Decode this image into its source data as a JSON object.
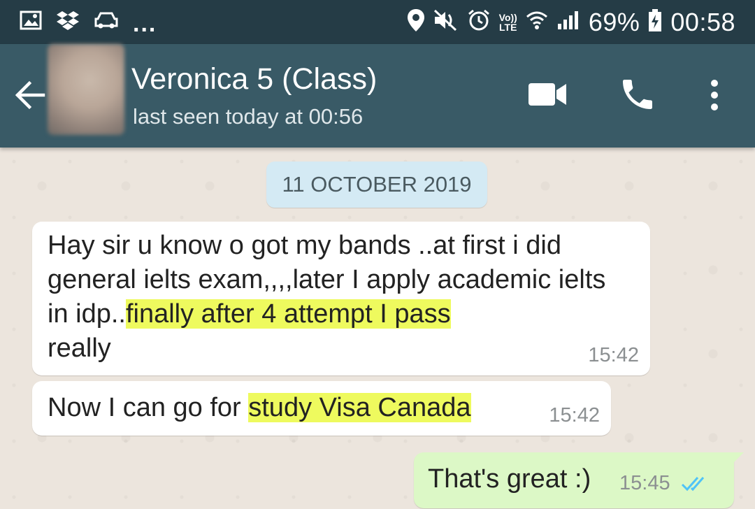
{
  "status_bar": {
    "battery": "69%",
    "time": "00:58",
    "volte_top": "Vo))",
    "volte_bottom": "LTE",
    "overflow": "...",
    "icons": [
      "gallery-icon",
      "dropbox-icon",
      "car-icon",
      "location-icon",
      "mute-icon",
      "alarm-icon",
      "volte-icon",
      "wifi-icon",
      "signal-icon",
      "battery-icon"
    ]
  },
  "header": {
    "contact_name": "Veronica 5 (Class)",
    "last_seen": "last seen today at 00:56",
    "icons": [
      "back-arrow-icon",
      "video-call-icon",
      "phone-call-icon",
      "more-options-icon"
    ]
  },
  "chat": {
    "date_chip": "11 OCTOBER 2019",
    "messages": [
      {
        "direction": "incoming",
        "segments": [
          "Hay sir u know o got my bands ..at first i did general ielts exam,,,,later I apply academic ielts in idp..",
          "finally after 4 attempt  I pass ",
          "really"
        ],
        "highlighted_segment": 1,
        "time": "15:42"
      },
      {
        "direction": "incoming",
        "segments": [
          "Now I can go for ",
          "study  Visa Canada "
        ],
        "highlighted_segment": 1,
        "time": "15:42"
      },
      {
        "direction": "outgoing",
        "text": "That's great :)",
        "time": "15:45",
        "status": "read"
      }
    ]
  },
  "colors": {
    "status_bar": "#253c46",
    "app_bar": "#395a66",
    "incoming_bubble": "#ffffff",
    "outgoing_bubble": "#dcf8c6",
    "highlight": "#eefa5e",
    "read_ticks": "#4fc3f7",
    "date_chip": "#d4eaf4"
  }
}
